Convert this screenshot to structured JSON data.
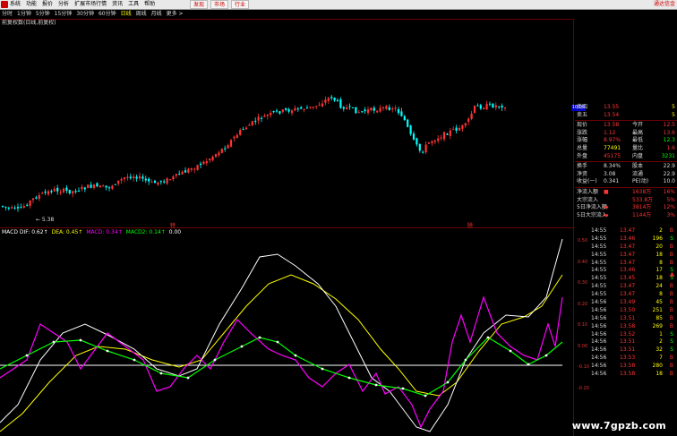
{
  "menubar": {
    "items": [
      "系统",
      "功能",
      "报价",
      "分析",
      "扩展市场行情",
      "资讯",
      "工具",
      "帮助"
    ],
    "ext_buttons": [
      "发现",
      "市场",
      "行业"
    ],
    "notice": "通达信金"
  },
  "periods": {
    "items": [
      "分时",
      "1分钟",
      "5分钟",
      "15分钟",
      "30分钟",
      "60分钟",
      "日线",
      "周线",
      "月线",
      "更多 >"
    ],
    "active_index": 6
  },
  "title": "前复权数(日线,前复权)",
  "kline": {
    "low_label": "5.38",
    "marker_labels": [
      "特",
      "除"
    ]
  },
  "indicator": {
    "items": [
      {
        "text": "MACD DIF: 0.62↑",
        "color": "#ffffff"
      },
      {
        "text": "DEA: 0.45↑",
        "color": "#ffff00"
      },
      {
        "text": "MACD: 0.34↑",
        "color": "#ff00ff"
      },
      {
        "text": "MACD2: 0.14↑",
        "color": "#00ff00"
      },
      {
        "text": "0.00",
        "color": "#ffffff"
      }
    ]
  },
  "axis": [
    "0.50",
    "0.40",
    "0.30",
    "0.20",
    "0.10",
    "0.00",
    "-0.10",
    "-0.20"
  ],
  "quote_tag": "10.06",
  "quote": [
    {
      "label": "卖四",
      "v1": "13.55",
      "c1": "#ff3333",
      "v2": "",
      "c2": "#ffff00",
      "v3": "5",
      "c3": "#ffff00"
    },
    {
      "label": "卖五",
      "v1": "13.54",
      "c1": "#ff3333",
      "v2": "",
      "c2": "#ffff00",
      "v3": "5",
      "c3": "#ffff00"
    },
    {
      "sep": true
    },
    {
      "label": "现价",
      "v1": "13.58",
      "c1": "#ff3333",
      "v2": "今开",
      "c2": "#dddddd",
      "v3": "12.5",
      "c3": "#ff3333"
    },
    {
      "label": "涨跌",
      "v1": "1.12",
      "c1": "#ff3333",
      "v2": "最高",
      "c2": "#dddddd",
      "v3": "13.6",
      "c3": "#ff3333"
    },
    {
      "label": "涨幅",
      "v1": "8.97%",
      "c1": "#ff3333",
      "v2": "最低",
      "c2": "#dddddd",
      "v3": "12.3",
      "c3": "#00ff00"
    },
    {
      "label": "总量",
      "v1": "77491",
      "c1": "#ffff00",
      "v2": "量比",
      "c2": "#dddddd",
      "v3": "1.6",
      "c3": "#ff3333"
    },
    {
      "label": "外盘",
      "v1": "45175",
      "c1": "#ff3333",
      "v2": "内盘",
      "c2": "#dddddd",
      "v3": "3231",
      "c3": "#00ff00"
    },
    {
      "sep": true
    },
    {
      "label": "换手",
      "v1": "8.34%",
      "c1": "#dddddd",
      "v2": "股本",
      "c2": "#dddddd",
      "v3": "22.9",
      "c3": "#dddddd"
    },
    {
      "label": "净资",
      "v1": "3.08",
      "c1": "#dddddd",
      "v2": "流通",
      "c2": "#dddddd",
      "v3": "22.9",
      "c3": "#dddddd"
    },
    {
      "label": "收益(一)",
      "v1": "0.341",
      "c1": "#dddddd",
      "v2": "PE(动)",
      "c2": "#dddddd",
      "v3": "10.0",
      "c3": "#dddddd"
    },
    {
      "sep": true
    },
    {
      "label": "净流入额",
      "v1": "■",
      "c1": "#ff3333",
      "v2": "1638万",
      "c2": "#ff3333",
      "v3": "16%",
      "c3": "#ff3333"
    },
    {
      "label": "大宗流入",
      "v1": "",
      "c1": "#ff3333",
      "v2": "533.8万",
      "c2": "#ff3333",
      "v3": "5%",
      "c3": "#ff3333"
    },
    {
      "label": "5日净流入额",
      "v1": "▬",
      "c1": "#ff3333",
      "v2": "3814万",
      "c2": "#ff3333",
      "v3": "12%",
      "c3": "#ff3333"
    },
    {
      "label": "5日大宗流入",
      "v1": "▬",
      "c1": "#ff3333",
      "v2": "1144万",
      "c2": "#ff3333",
      "v3": "3%",
      "c3": "#ff3333"
    }
  ],
  "ticks": [
    {
      "time": "14:55",
      "price": "13.47",
      "vol": "2",
      "dir": "B"
    },
    {
      "time": "14:55",
      "price": "13.46",
      "vol": "196",
      "dir": "S"
    },
    {
      "time": "14:55",
      "price": "13.47",
      "vol": "20",
      "dir": "B"
    },
    {
      "time": "14:55",
      "price": "13.47",
      "vol": "18",
      "dir": "B"
    },
    {
      "time": "14:55",
      "price": "13.47",
      "vol": "8",
      "dir": "B"
    },
    {
      "time": "14:55",
      "price": "13.46",
      "vol": "17",
      "dir": "S"
    },
    {
      "time": "14:55",
      "price": "13.45",
      "vol": "18",
      "dir": "S"
    },
    {
      "time": "14:55",
      "price": "13.47",
      "vol": "24",
      "dir": "B"
    },
    {
      "time": "14:55",
      "price": "13.47",
      "vol": "8",
      "dir": "B"
    },
    {
      "time": "14:56",
      "price": "13.49",
      "vol": "45",
      "dir": "B"
    },
    {
      "time": "14:56",
      "price": "13.50",
      "vol": "251",
      "dir": "B"
    },
    {
      "time": "14:56",
      "price": "13.51",
      "vol": "85",
      "dir": "B"
    },
    {
      "time": "14:56",
      "price": "13.58",
      "vol": "269",
      "dir": "B"
    },
    {
      "time": "14:56",
      "price": "13.52",
      "vol": "1",
      "dir": "S"
    },
    {
      "time": "14:56",
      "price": "13.51",
      "vol": "2",
      "dir": "S"
    },
    {
      "time": "14:56",
      "price": "13.51",
      "vol": "32",
      "dir": "S"
    },
    {
      "time": "14:56",
      "price": "13.53",
      "vol": "7",
      "dir": "B"
    },
    {
      "time": "14:56",
      "price": "13.58",
      "vol": "280",
      "dir": "B"
    },
    {
      "time": "14:56",
      "price": "13.58",
      "vol": "18",
      "dir": "B"
    }
  ],
  "watermark": "www.7gpzb.com",
  "colors": {
    "up": "#ff3333",
    "down": "#00ffff",
    "grid": "#6a0000",
    "dif": "#ffffff",
    "dea": "#ffff00",
    "macd": "#ff00ff",
    "macd2": "#00ff00"
  }
}
